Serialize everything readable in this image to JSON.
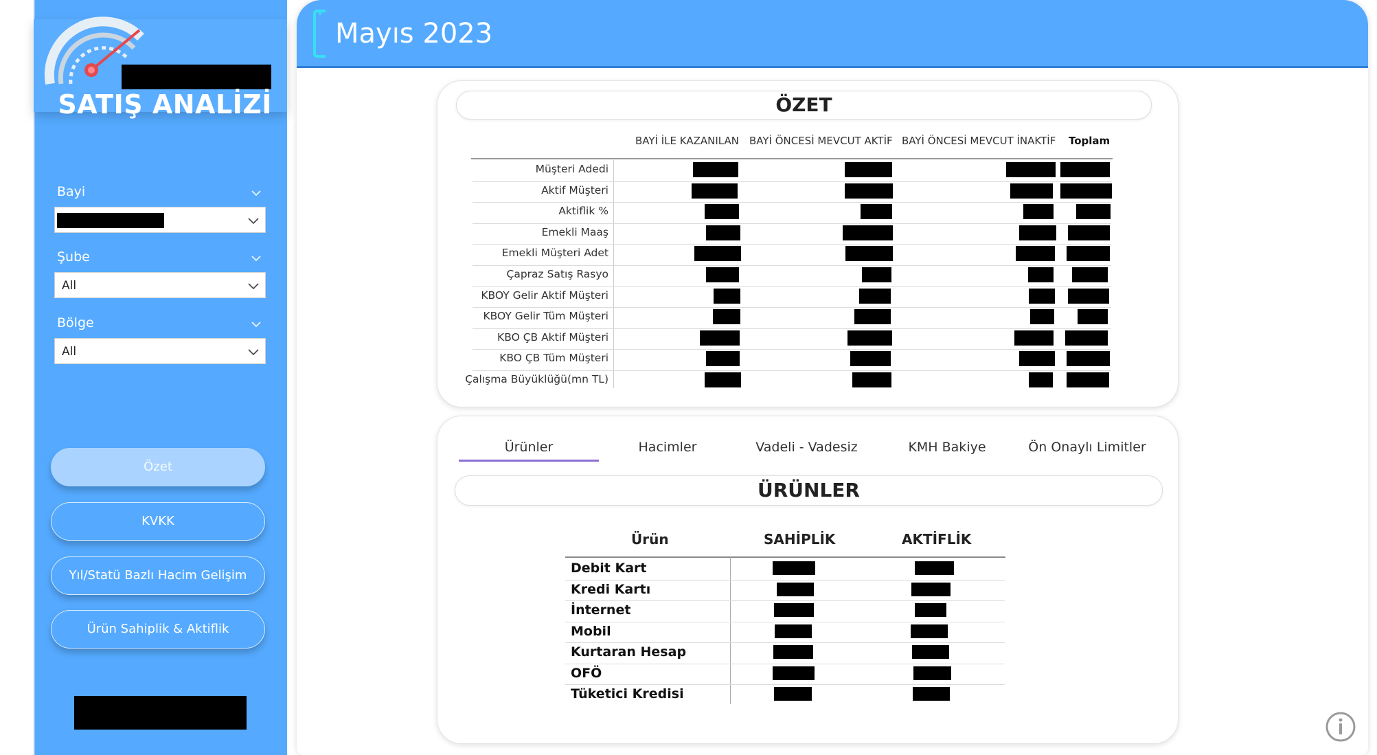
{
  "sidebar": {
    "app_title": "SATIŞ ANALİZİ",
    "filters": [
      {
        "label": "Bayi",
        "value": ""
      },
      {
        "label": "Şube",
        "value": "All"
      },
      {
        "label": "Bölge",
        "value": "All"
      }
    ],
    "nav": [
      {
        "label": "Özet",
        "active": true
      },
      {
        "label": "KVKK"
      },
      {
        "label": "Yıl/Statü Bazlı Hacim Gelişim"
      },
      {
        "label": "Ürün Sahiplik & Aktiflik"
      }
    ],
    "bg_color": "#55aaff"
  },
  "header": {
    "title": "Mayıs 2023",
    "color": "#55aaff"
  },
  "ozet": {
    "title": "ÖZET",
    "columns": [
      "BAYİ İLE KAZANILAN",
      "BAYİ ÖNCESİ MEVCUT AKTİF",
      "BAYİ ÖNCESİ MEVCUT İNAKTİF",
      "Toplam"
    ],
    "rows": [
      "Müşteri Adedi",
      "Aktif Müşteri",
      "Aktiflik %",
      "Emekli Maaş",
      "Emekli Müşteri Adet",
      "Çapraz Satış Rasyo",
      "KBOY Gelir Aktif Müşteri",
      "KBOY Gelir Tüm Müşteri",
      "KBO ÇB Aktif Müşteri",
      "KBO ÇB Tüm Müşteri",
      "Çalışma Büyüklüğü(mn TL)"
    ]
  },
  "tabs": [
    {
      "label": "Ürünler",
      "active": true
    },
    {
      "label": "Hacimler"
    },
    {
      "label": "Vadeli - Vadesiz"
    },
    {
      "label": "KMH Bakiye"
    },
    {
      "label": "Ön Onaylı Limitler"
    }
  ],
  "urunler": {
    "title": "ÜRÜNLER",
    "columns": [
      "Ürün",
      "SAHİPLİK",
      "AKTİFLİK"
    ],
    "rows": [
      "Debit Kart",
      "Kredi Kartı",
      "İnternet",
      "Mobil",
      "Kurtaran Hesap",
      "OFÖ",
      "Tüketici Kredisi"
    ]
  },
  "accent_color": "#8b6fd6"
}
